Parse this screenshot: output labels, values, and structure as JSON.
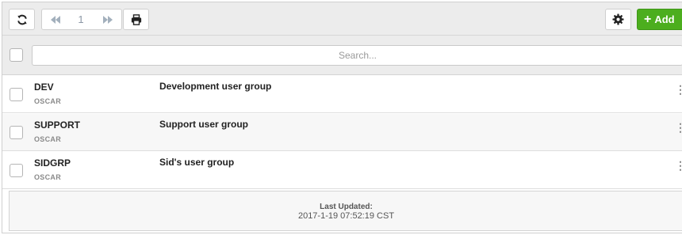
{
  "toolbar": {
    "refresh_icon": "refresh-icon",
    "first_icon": "rewind-icon",
    "page_number": "1",
    "next_icon": "fast-forward-icon",
    "print_icon": "print-icon",
    "settings_icon": "gear-icon",
    "add_label": "Add",
    "add_color": "#4cae1e"
  },
  "search": {
    "placeholder": "Search...",
    "value": ""
  },
  "rows": [
    {
      "name": "DEV",
      "owner": "OSCAR",
      "description": "Development user group"
    },
    {
      "name": "SUPPORT",
      "owner": "OSCAR",
      "description": "Support user group"
    },
    {
      "name": "SIDGRP",
      "owner": "OSCAR",
      "description": "Sid's user group"
    }
  ],
  "footer": {
    "label": "Last Updated:",
    "timestamp": "2017-1-19 07:52:19 CST"
  }
}
